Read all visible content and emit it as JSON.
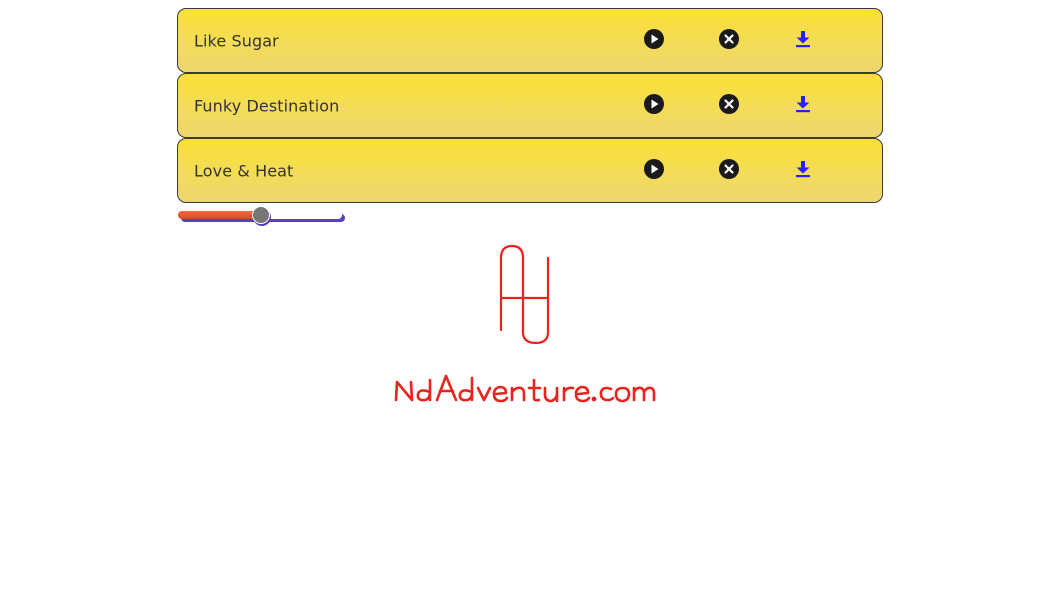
{
  "playlist": {
    "tracks": [
      {
        "title": "Like Sugar"
      },
      {
        "title": "Funky Destination"
      },
      {
        "title": "Love & Heat"
      }
    ]
  },
  "volume": {
    "level": 0.5
  },
  "logo": {
    "text": "NdAdventure.com"
  },
  "colors": {
    "track_bg_top": "#fbe033",
    "track_bg_bottom": "#eed571",
    "download_icon": "#2a1fff",
    "logo": "#e8241f",
    "slider_fill": "#e0452b",
    "slider_shadow": "#5a3fc0"
  },
  "icons": {
    "play": "play-circle-icon",
    "remove": "close-circle-icon",
    "download": "download-icon"
  }
}
